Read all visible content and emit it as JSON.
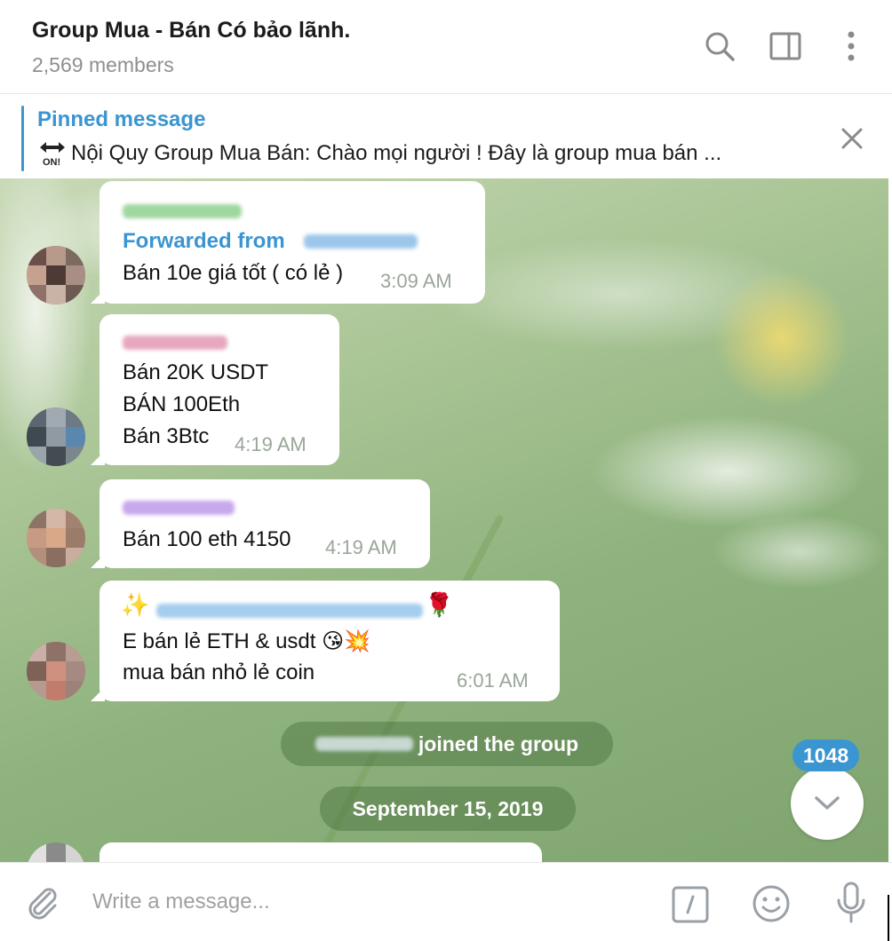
{
  "header": {
    "title": "Group Mua - Bán Có bảo lãnh.",
    "subtitle": "2,569 members",
    "icons": [
      "search-icon",
      "sidebar-toggle-icon",
      "more-vertical-icon"
    ]
  },
  "pinned": {
    "label": "Pinned message",
    "text": "Nội Quy Group Mua Bán:  Chào mọi người ! Đây là group mua bán ..."
  },
  "messages": [
    {
      "forwarded_label": "Forwarded from",
      "lines": [
        "Bán 10e giá tốt ( có lẻ )"
      ],
      "time": "3:09 AM"
    },
    {
      "lines": [
        "Bán 20K USDT",
        "BÁN 100Eth",
        "Bán 3Btc"
      ],
      "time": "4:19 AM"
    },
    {
      "lines": [
        "Bán 100 eth 4150"
      ],
      "time": "4:19 AM"
    },
    {
      "lines": [
        "E bán lẻ ETH  & usdt 😘💥",
        "mua bán nhỏ lẻ coin"
      ],
      "time": "6:01 AM"
    }
  ],
  "service": {
    "joined": "joined the group",
    "date": "September 15, 2019"
  },
  "unread_count": "1048",
  "composer": {
    "placeholder": "Write a message..."
  },
  "colors": {
    "accent": "#3a95d1",
    "name_green": "#5fb86a",
    "name_pink": "#d9709a",
    "name_purple": "#9b6fd6",
    "name_blue": "#3a95d1"
  }
}
